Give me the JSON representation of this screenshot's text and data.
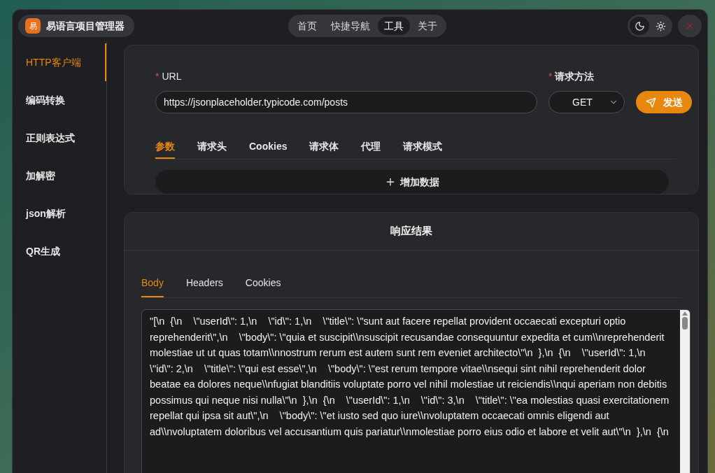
{
  "app": {
    "logo": "易",
    "title": "易语言项目管理器"
  },
  "nav": [
    {
      "label": "首页",
      "selected": false
    },
    {
      "label": "快捷导航",
      "selected": false
    },
    {
      "label": "工具",
      "selected": true
    },
    {
      "label": "关于",
      "selected": false
    }
  ],
  "theme": {
    "dark_selected": true
  },
  "sidebar": {
    "items": [
      {
        "label": "HTTP客户端",
        "selected": true
      },
      {
        "label": "编码转换",
        "selected": false
      },
      {
        "label": "正则表达式",
        "selected": false
      },
      {
        "label": "加解密",
        "selected": false
      },
      {
        "label": "json解析",
        "selected": false
      },
      {
        "label": "QR生成",
        "selected": false
      }
    ]
  },
  "request": {
    "url_label": "URL",
    "url_mark": "*",
    "url": "https://jsonplaceholder.typicode.com/posts",
    "method_label": "请求方法",
    "method_mark": "*",
    "method": "GET",
    "send": "发送",
    "tabs": [
      {
        "label": "参数",
        "selected": true
      },
      {
        "label": "请求头",
        "selected": false
      },
      {
        "label": "Cookies",
        "selected": false
      },
      {
        "label": "请求体",
        "selected": false
      },
      {
        "label": "代理",
        "selected": false
      },
      {
        "label": "请求模式",
        "selected": false
      }
    ],
    "add_data": "增加数据"
  },
  "response": {
    "title": "响应结果",
    "tabs": [
      {
        "label": "Body",
        "selected": true
      },
      {
        "label": "Headers",
        "selected": false
      },
      {
        "label": "Cookies",
        "selected": false
      }
    ],
    "body_lines": [
      "\"[\\n  {\\n    \\\"userId\\\": 1,\\n    \\\"id\\\": 1,\\n    \\\"title\\\": \\\"sunt aut facere repellat provident occaecati excepturi optio",
      "reprehenderit\\\",\\n    \\\"body\\\": \\\"quia et suscipit\\\\nsuscipit recusandae consequuntur expedita et cum\\\\nreprehenderit",
      "molestiae ut ut quas totam\\\\nnostrum rerum est autem sunt rem eveniet architecto\\\"\\n  },\\n  {\\n    \\\"userId\\\": 1,\\n",
      "\\\"id\\\": 2,\\n    \\\"title\\\": \\\"qui est esse\\\",\\n    \\\"body\\\": \\\"est rerum tempore vitae\\\\nsequi sint nihil reprehenderit dolor",
      "beatae ea dolores neque\\\\nfugiat blanditiis voluptate porro vel nihil molestiae ut reiciendis\\\\nqui aperiam non debitis",
      "possimus qui neque nisi nulla\\\"\\n  },\\n  {\\n    \\\"userId\\\": 1,\\n    \\\"id\\\": 3,\\n    \\\"title\\\": \\\"ea molestias quasi exercitationem",
      "repellat qui ipsa sit aut\\\",\\n    \\\"body\\\": \\\"et iusto sed quo iure\\\\nvoluptatem occaecati omnis eligendi aut",
      "ad\\\\nvoluptatem doloribus vel accusantium quis pariatur\\\\nmolestiae porro eius odio et labore et velit aut\\\"\\n  },\\n  {\\n"
    ]
  }
}
